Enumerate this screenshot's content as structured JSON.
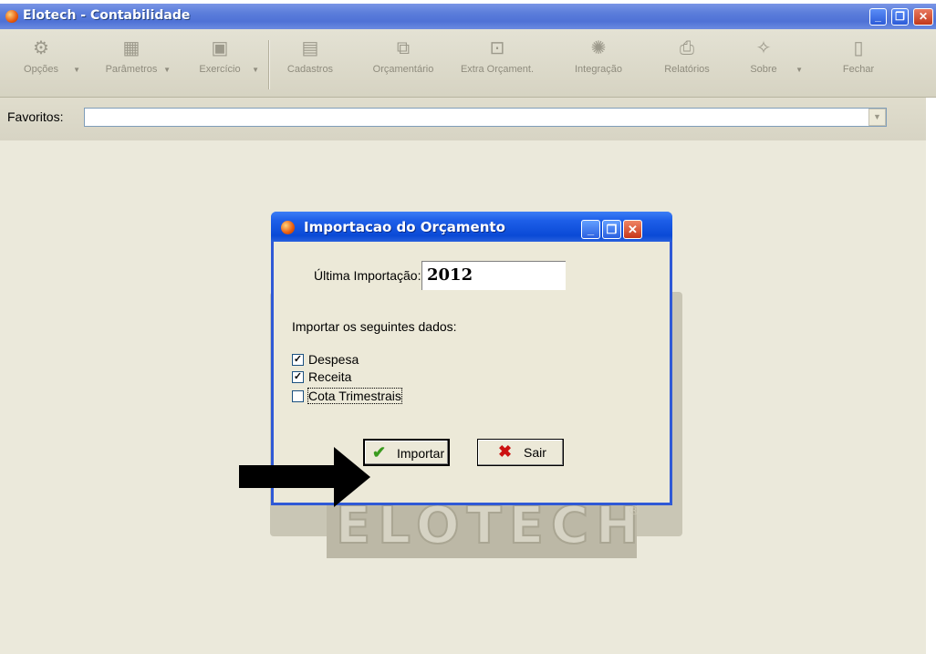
{
  "window": {
    "title": "Elotech - Contabilidade",
    "min_glyph": "_",
    "max_glyph": "❐",
    "close_glyph": "✕"
  },
  "toolbar": {
    "items": [
      {
        "label": "Opções",
        "icon": "gears-icon",
        "glyph": "⚙",
        "has_dropdown": true
      },
      {
        "label": "Parâmetros",
        "icon": "table-icon",
        "glyph": "▦",
        "has_dropdown": true
      },
      {
        "label": "Exercício",
        "icon": "calendar-icon",
        "glyph": "▣",
        "has_dropdown": true
      },
      {
        "label": "Cadastros",
        "icon": "register-icon",
        "glyph": "▤",
        "has_dropdown": false
      },
      {
        "label": "Orçamentário",
        "icon": "budget-icon",
        "glyph": "⧉",
        "has_dropdown": false
      },
      {
        "label": "Extra Orçament.",
        "icon": "extra-budget-icon",
        "glyph": "⊡",
        "has_dropdown": false
      },
      {
        "label": "Integração",
        "icon": "integration-icon",
        "glyph": "✺",
        "has_dropdown": false
      },
      {
        "label": "Relatórios",
        "icon": "printer-icon",
        "glyph": "⎙",
        "has_dropdown": false
      },
      {
        "label": "Sobre",
        "icon": "about-icon",
        "glyph": "✧",
        "has_dropdown": true
      },
      {
        "label": "Fechar",
        "icon": "exit-door-icon",
        "glyph": "▯",
        "has_dropdown": false
      }
    ],
    "dropdown_glyph": "▼"
  },
  "favorites": {
    "label": "Favoritos:",
    "value": "",
    "dropdown_glyph": "▼"
  },
  "dialog": {
    "title": "Importacao do Orçamento",
    "ultima_label": "Última Importação:",
    "ultima_value": "2012",
    "importar_label": "Importar os seguintes dados:",
    "options": [
      {
        "label": "Despesa",
        "checked": true,
        "mark": "✓"
      },
      {
        "label": "Receita",
        "checked": true,
        "mark": "✓"
      },
      {
        "label": "Cota Trimestrais",
        "checked": false,
        "mark": ""
      }
    ],
    "importar_button": "Importar",
    "sair_button": "Sair",
    "importar_glyph": "✔",
    "sair_glyph": "✖"
  },
  "background_logo": {
    "text": "ELOTECH",
    "reg": "®"
  },
  "colors": {
    "titlebar": "#5c7edb",
    "dialog_title": "#0a4ad6",
    "desktop": "#ebe9db",
    "importar_check": "#3a9a1e",
    "sair_x": "#cc1111"
  }
}
